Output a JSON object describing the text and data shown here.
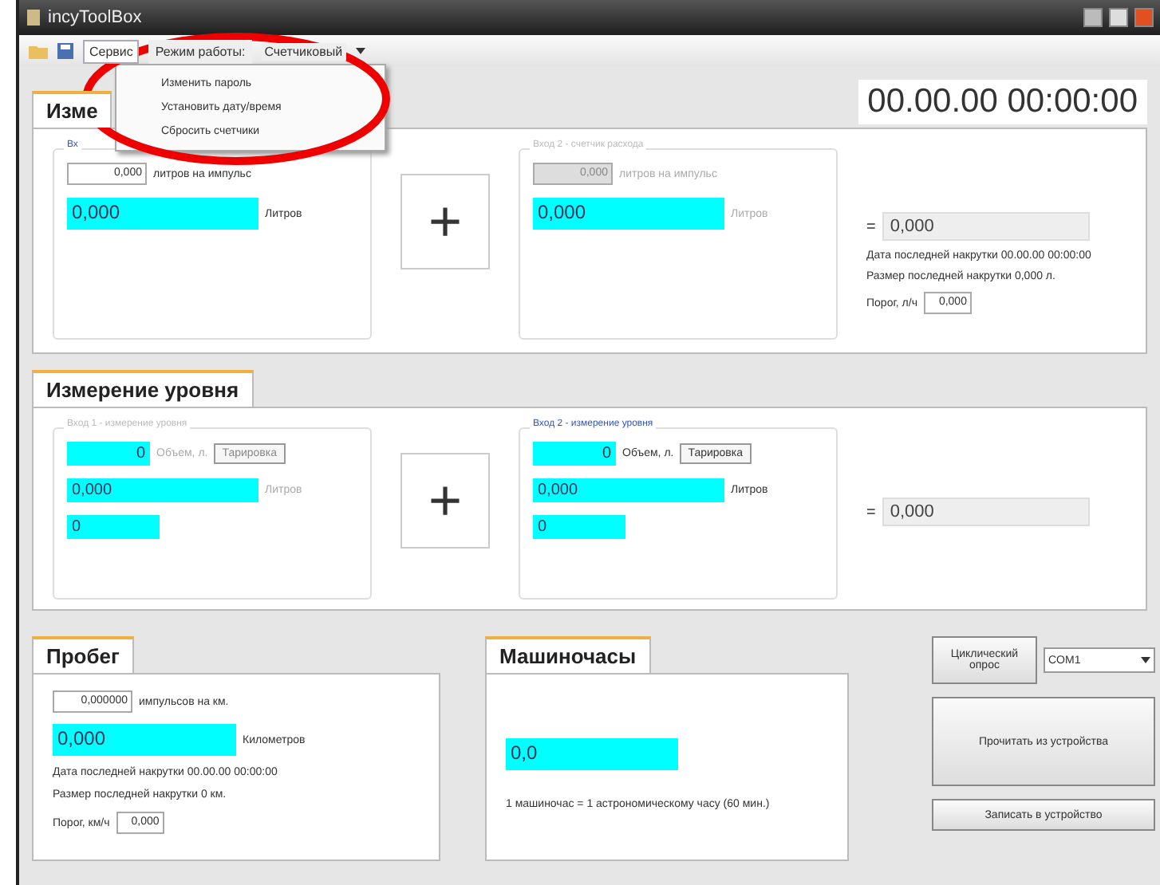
{
  "window": {
    "title": "incyToolBox"
  },
  "toolbar": {
    "menus": [
      {
        "label": "Сервис",
        "open": true
      },
      {
        "label": "Режим работы:",
        "open": false
      }
    ],
    "mode": "Счетчиковый",
    "dropdown": [
      "Изменить пароль",
      "Установить дату/время",
      "Сбросить счетчики"
    ]
  },
  "clock": "00.00.00 00:00:00",
  "flow": {
    "tab": "Изме",
    "inputs": [
      {
        "legend": "Вх",
        "disabled": false,
        "per_pulse": "0,000",
        "per_pulse_label": "литров на импульс",
        "value": "0,000",
        "unit": "Литров"
      },
      {
        "legend": "Вход 2 - счетчик расхода",
        "disabled": true,
        "per_pulse": "0,000",
        "per_pulse_label": "литров на импульс",
        "value": "0,000",
        "unit": "Литров"
      }
    ],
    "plus": "+",
    "equals": "=",
    "total": "0,000",
    "last_date": "Дата последней накрутки 00.00.00 00:00:00",
    "last_size": "Размер последней накрутки 0,000 л.",
    "threshold_label": "Порог, л/ч",
    "threshold": "0,000"
  },
  "level": {
    "tab": "Измерение уровня",
    "inputs": [
      {
        "legend": "Вход 1 - измерение уровня",
        "disabled": true,
        "volume": "0",
        "volume_label": "Объем, л.",
        "button": "Тарировка",
        "value": "0,000",
        "unit": "Литров",
        "raw": "0"
      },
      {
        "legend": "Вход 2 - измерение уровня",
        "disabled": false,
        "volume": "0",
        "volume_label": "Объем, л.",
        "button": "Тарировка",
        "value": "0,000",
        "unit": "Литров",
        "raw": "0"
      }
    ],
    "plus": "+",
    "equals": "=",
    "total": "0,000"
  },
  "mileage": {
    "tab": "Пробег",
    "per_km": "0,000000",
    "per_km_label": "импульсов на км.",
    "value": "0,000",
    "unit": "Километров",
    "last_date": "Дата последней накрутки 00.00.00 00:00:00",
    "last_size": "Размер последней накрутки 0 км.",
    "threshold_label": "Порог, км/ч",
    "threshold": "0,000"
  },
  "hours": {
    "tab": "Машиночасы",
    "value": "0,0",
    "note": "1 машиночас = 1 астрономическому часу (60 мин.)"
  },
  "actions": {
    "cyclic": "Циклический опрос",
    "port": "COM1",
    "read": "Прочитать из устройства",
    "write": "Записать в устройство"
  }
}
